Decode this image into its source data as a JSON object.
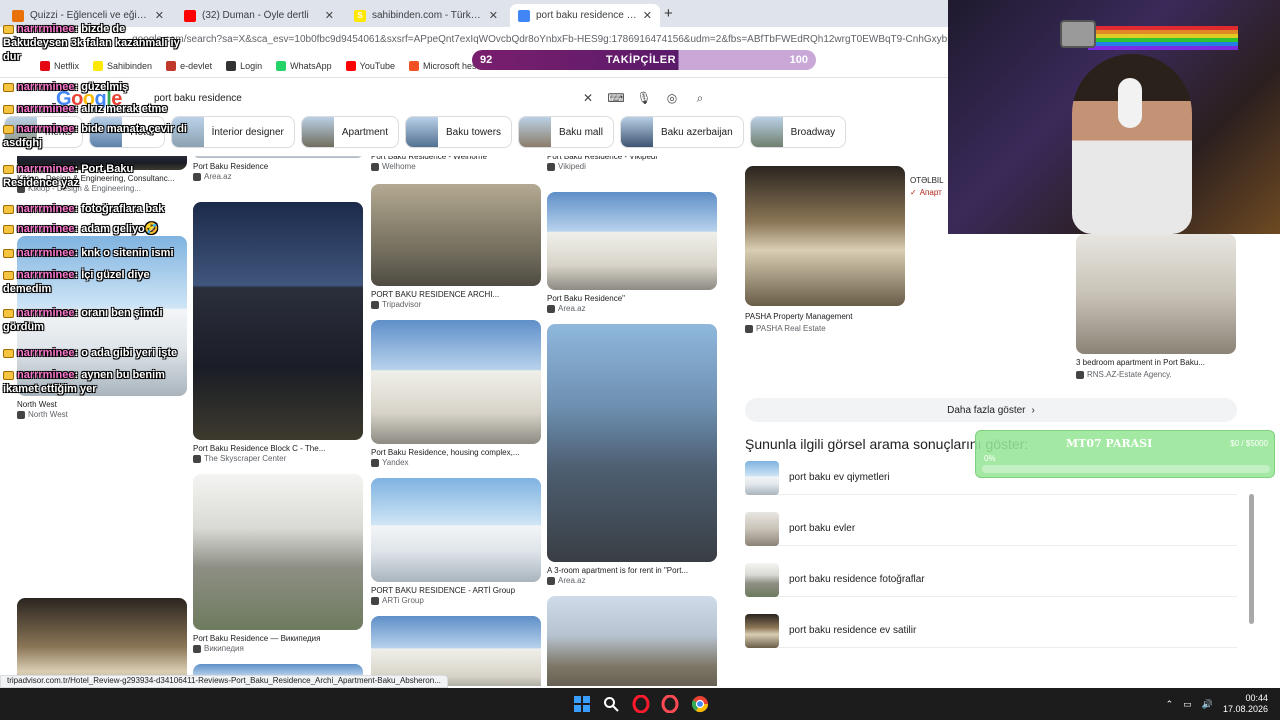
{
  "browser": {
    "tabs": [
      {
        "label": "Quizzi - Eğlenceli ve eğitimli",
        "favicon_color": "#e8710a",
        "active": false
      },
      {
        "label": "(32) Duman - Öyle dertli",
        "favicon_color": "#ff0000",
        "active": false
      },
      {
        "label": "sahibinden.com - Türkiye'nin Ö",
        "favicon_color": "#ffe800",
        "favicon_text": "S",
        "active": false
      },
      {
        "label": "port baku residence - Google'd",
        "favicon_color": "#4285f4",
        "active": true
      }
    ],
    "url": "google.com/search?sa=X&sca_esv=10b0fbc9d9454061&sxsrf=APpeQnt7exIqWOvcbQdr8oYnbxFb-HES9g:1786916474156&udm=2&fbs=ABfTbFWEdRQh12wrgT0EWBqT9-CnhGxybi9L16Kt_IVXDRF1PY",
    "bookmarks": [
      {
        "label": "Netflix",
        "color": "#e50914"
      },
      {
        "label": "Sahibinden",
        "color": "#ffe800"
      },
      {
        "label": "e-devlet",
        "color": "#c0392b"
      },
      {
        "label": "Login",
        "color": "#333333"
      },
      {
        "label": "WhatsApp",
        "color": "#25d366"
      },
      {
        "label": "YouTube",
        "color": "#ff0000"
      },
      {
        "label": "Microsoft hesabınız...",
        "color": "#f25022"
      }
    ]
  },
  "followers": {
    "current": "92",
    "label": "TAKİPÇİLER",
    "goal": "100",
    "progress_fraction": 0.6
  },
  "google": {
    "logo_letters": [
      "G",
      "o",
      "o",
      "g",
      "l",
      "e"
    ],
    "query": "port baku residence",
    "chips": [
      {
        "label": "ments",
        "color": "#8a8f78"
      },
      {
        "label": "Hotel",
        "color": "#5b7fa8"
      },
      {
        "label": "İnterior designer",
        "color": "#8aa0b0"
      },
      {
        "label": "Apartment",
        "color": "#6e6a5a"
      },
      {
        "label": "Baku towers",
        "color": "#4f6e8f"
      },
      {
        "label": "Baku mall",
        "color": "#8a7a65"
      },
      {
        "label": "Baku azerbaijan",
        "color": "#39506e"
      },
      {
        "label": "Broadway",
        "color": "#6c7c6a"
      }
    ]
  },
  "images": {
    "col1": [
      {
        "title": "Kiklop - Design & Engineering, Consultanc...",
        "source": "Kiklop - Design & Engineering...",
        "cls": "sky2"
      },
      {
        "title": "North West",
        "source": "North West",
        "cls": "sky1"
      },
      {
        "title": "",
        "source": "",
        "cls": "lobby"
      }
    ],
    "col2": [
      {
        "title": "Port Baku Residence",
        "source": "Area.az",
        "cls": "sky1"
      },
      {
        "title": "Port Baku Residence Block C - The...",
        "source": "The Skyscraper Center",
        "cls": "sky2"
      },
      {
        "title": "Port Baku Residence — Википедия",
        "source": "Википедия",
        "cls": "model"
      },
      {
        "title": "",
        "source": "",
        "cls": "sky3"
      }
    ],
    "col3": [
      {
        "title": "Port Baku Residence - Welhome",
        "source": "Welhome",
        "cls": "sky1"
      },
      {
        "title": "PORT BAKU RESIDENCE ARCHI...",
        "source": "Tripadvisor",
        "cls": "old"
      },
      {
        "title": "Port Baku Residence, housing complex,...",
        "source": "Yandex",
        "cls": "sky3"
      },
      {
        "title": "PORT BAKU RESIDENCE - ARTİ Group",
        "source": "ARTi Group",
        "cls": "sky1"
      },
      {
        "title": "",
        "source": "",
        "cls": "sky3"
      }
    ],
    "col4": [
      {
        "title": "Port Baku Residence - Vikipedi",
        "source": "Vikipedi",
        "cls": "sky1"
      },
      {
        "title": "Port Baku Residence\"",
        "source": "Area.az",
        "cls": "sky3"
      },
      {
        "title": "A 3-room apartment is for rent in \"Port...",
        "source": "Area.az",
        "cls": "glass"
      },
      {
        "title": "",
        "source": "",
        "cls": "crane"
      }
    ],
    "col5": [
      {
        "title": "PASHA Property Management",
        "source": "PASHA Real Estate",
        "cls": "lobby"
      }
    ],
    "col6": [
      {
        "title": "3 bedroom apartment in Port Baku...",
        "source": "RNS.AZ-Estate Agency.",
        "cls": "room"
      }
    ],
    "partial_label": "OTƏLBIL",
    "partial_source": "Апарт"
  },
  "more_button": "Daha fazla göster",
  "related": {
    "title": "Şununla ilgili görsel arama sonuçlarını göster:",
    "items": [
      {
        "label": "port baku ev qiymetleri",
        "cls": "sky1"
      },
      {
        "label": "port baku evler",
        "cls": "room"
      },
      {
        "label": "port baku residence fotoğraflar",
        "cls": "model"
      },
      {
        "label": "port baku residence ev satilir",
        "cls": "lobby"
      }
    ]
  },
  "status_url": "tripadvisor.com.tr/Hotel_Review-g293934-d34106411-Reviews-Port_Baku_Residence_Archi_Apartment-Baku_Absheron...",
  "mt_overlay": {
    "title": "MT07 PARASI",
    "amount": "$0 / $5000",
    "percent_label": "0%",
    "progress": 0
  },
  "chat": [
    {
      "user": "narrrminee",
      "text": ": bizde de Bakudeysen 3k falan kazanmali iy dur"
    },
    {
      "user": "narrrminee",
      "text": ": güzelmiş"
    },
    {
      "user": "narrrminee",
      "text": ": alrız merak etme"
    },
    {
      "user": "narrrminee",
      "text": ": bide manata çevir di asdfghj"
    },
    {
      "user": "narrrminee",
      "text": ": Port Baku Residence yaz"
    },
    {
      "user": "narrrminee",
      "text": ": fotoğraflara bak"
    },
    {
      "user": "narrrminee",
      "text": ": adam geliyo🤣"
    },
    {
      "user": "narrrminee",
      "text": ": knk o sitenin ismi"
    },
    {
      "user": "narrrminee",
      "text": ": İçi güzel diye demedim"
    },
    {
      "user": "narrrminee",
      "text": ": oranı ben şimdi gördüm"
    },
    {
      "user": "narrrminee",
      "text": ": o ada gibi yeri işte"
    },
    {
      "user": "narrrminee",
      "text": ": aynen bu benim ikamet ettiğim yer"
    }
  ],
  "taskbar": {
    "time": "00:44",
    "date": "17.08.2026",
    "apps": [
      {
        "name": "windows-start-icon",
        "color": "#3aa0ff"
      },
      {
        "name": "search-icon",
        "color": "#ffffff"
      },
      {
        "name": "opera-icon",
        "color": "#ff1b2d"
      },
      {
        "name": "opera-gx-icon",
        "color": "#ff4a55"
      },
      {
        "name": "chrome-icon",
        "color": "#4285f4"
      }
    ]
  }
}
